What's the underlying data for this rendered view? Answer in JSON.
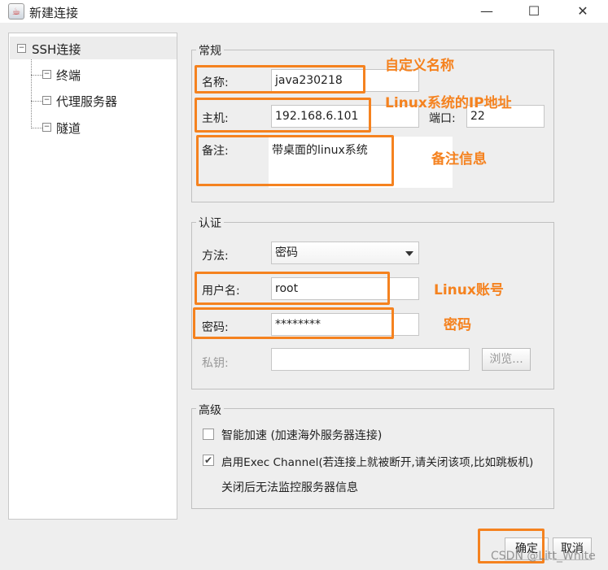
{
  "window": {
    "title": "新建连接",
    "minimize": "—",
    "maximize": "☐",
    "close": "✕",
    "icon": "java-icon"
  },
  "tree": {
    "root": "SSH连接",
    "children": [
      "终端",
      "代理服务器",
      "隧道"
    ]
  },
  "general": {
    "legend": "常规",
    "name_label": "名称:",
    "name_value": "java230218",
    "host_label": "主机:",
    "host_value": "192.168.6.101",
    "port_label": "端口:",
    "port_value": "22",
    "remark_label": "备注:",
    "remark_value": "带桌面的linux系统"
  },
  "auth": {
    "legend": "认证",
    "method_label": "方法:",
    "method_value": "密码",
    "user_label": "用户名:",
    "user_value": "root",
    "password_label": "密码:",
    "password_value": "********",
    "key_label": "私钥:",
    "key_value": "",
    "browse": "浏览..."
  },
  "advanced": {
    "legend": "高级",
    "accel_label": "智能加速 (加速海外服务器连接)",
    "accel_checked": false,
    "exec_label": "启用Exec Channel(若连接上就被断开,请关闭该项,比如跳板机)",
    "exec_checked": true,
    "exec_note": "关闭后无法监控服务器信息"
  },
  "buttons": {
    "ok": "确定",
    "cancel": "取消"
  },
  "annotations": {
    "name": "自定义名称",
    "host": "Linux系统的IP地址",
    "remark": "备注信息",
    "user": "Linux账号",
    "password": "密码",
    "color": "#f5821f"
  },
  "watermark": "CSDN @Litt_White"
}
